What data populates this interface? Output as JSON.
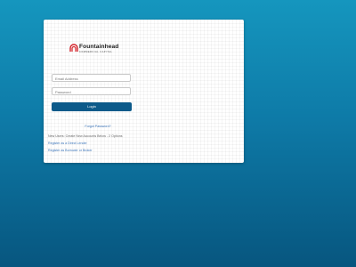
{
  "brand": {
    "name": "Fountainhead",
    "tagline": "COMMERCIAL CAPITAL",
    "accent_color": "#d4232a",
    "icon": "arch-logo-icon"
  },
  "login_form": {
    "email_placeholder": "Email Address",
    "password_placeholder": "Password",
    "login_label": "Login",
    "button_color": "#0c5a8a"
  },
  "links": {
    "forgot_password": "Forgot Password?",
    "new_user_notice": "New Users: Create New Accounts Below - 2 Options",
    "register_lender": "Register as a Direct Lender",
    "register_borrower": "Register as Borrower or Broker"
  }
}
